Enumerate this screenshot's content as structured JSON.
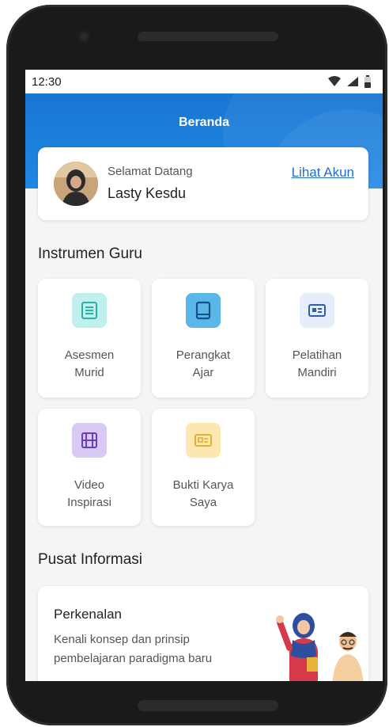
{
  "status_bar": {
    "time": "12:30"
  },
  "header": {
    "title": "Beranda"
  },
  "account": {
    "greeting": "Selamat Datang",
    "name": "Lasty Kesdu",
    "link_label": "Lihat Akun"
  },
  "instruments": {
    "title": "Instrumen Guru",
    "items": [
      {
        "line1": "Asesmen",
        "line2": "Murid",
        "icon": "list-document-icon",
        "color": "#bff0ee",
        "accent": "#2bb3a6"
      },
      {
        "line1": "Perangkat",
        "line2": "Ajar",
        "icon": "book-icon",
        "color": "#5bb6ea",
        "accent": "#1f78b5"
      },
      {
        "line1": "Pelatihan",
        "line2": "Mandiri",
        "icon": "id-card-icon",
        "color": "#e6eefb",
        "accent": "#2d5fa8"
      },
      {
        "line1": "Video",
        "line2": "Inspirasi",
        "icon": "film-icon",
        "color": "#d9c9f5",
        "accent": "#6b3fb8"
      },
      {
        "line1": "Bukti Karya",
        "line2": "Saya",
        "icon": "certificate-icon",
        "color": "#fde7b0",
        "accent": "#e0a92c"
      }
    ]
  },
  "info_center": {
    "title": "Pusat Informasi",
    "card": {
      "title": "Perkenalan",
      "description": "Kenali konsep dan prinsip pembelajaran paradigma baru"
    }
  }
}
